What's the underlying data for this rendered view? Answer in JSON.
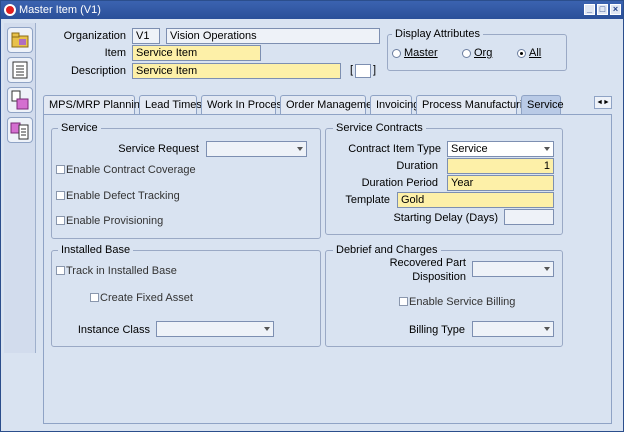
{
  "window": {
    "title": "Master Item (V1)"
  },
  "header": {
    "org_label": "Organization",
    "org_code": "V1",
    "org_name": "Vision Operations",
    "item_label": "Item",
    "item_value": "Service Item",
    "desc_label": "Description",
    "desc_value": "Service Item",
    "flex_bracket_open": "[",
    "flex_bracket_close": "]"
  },
  "display_attributes": {
    "title": "Display Attributes",
    "options": [
      "Master",
      "Org",
      "All"
    ],
    "selected": "All"
  },
  "tabs": [
    "MPS/MRP Planning",
    "Lead Times",
    "Work In Process",
    "Order Management",
    "Invoicing",
    "Process Manufacturing",
    "Service"
  ],
  "active_tab": "Service",
  "service": {
    "title": "Service",
    "request_label": "Service Request",
    "request_value": "",
    "contract_coverage": "Enable Contract Coverage",
    "defect_tracking": "Enable Defect Tracking",
    "provisioning": "Enable Provisioning"
  },
  "service_contracts": {
    "title": "Service Contracts",
    "item_type_label": "Contract Item Type",
    "item_type_value": "Service",
    "duration_label": "Duration",
    "duration_value": "1",
    "period_label": "Duration Period",
    "period_value": "Year",
    "template_label": "Template",
    "template_value": "Gold",
    "delay_label": "Starting Delay (Days)",
    "delay_value": ""
  },
  "installed_base": {
    "title": "Installed Base",
    "track_label": "Track in Installed Base",
    "fixed_asset_label": "Create Fixed Asset",
    "instance_class_label": "Instance Class",
    "instance_class_value": ""
  },
  "debrief": {
    "title": "Debrief and Charges",
    "recovered_label_1": "Recovered Part",
    "recovered_label_2": "Disposition",
    "recovered_value": "",
    "billing_enable_label": "Enable Service Billing",
    "billing_type_label": "Billing Type",
    "billing_type_value": ""
  },
  "colors": {
    "required": "#fdf0a8",
    "background": "#d9e3f1",
    "titlebar": "#2a4f99"
  }
}
